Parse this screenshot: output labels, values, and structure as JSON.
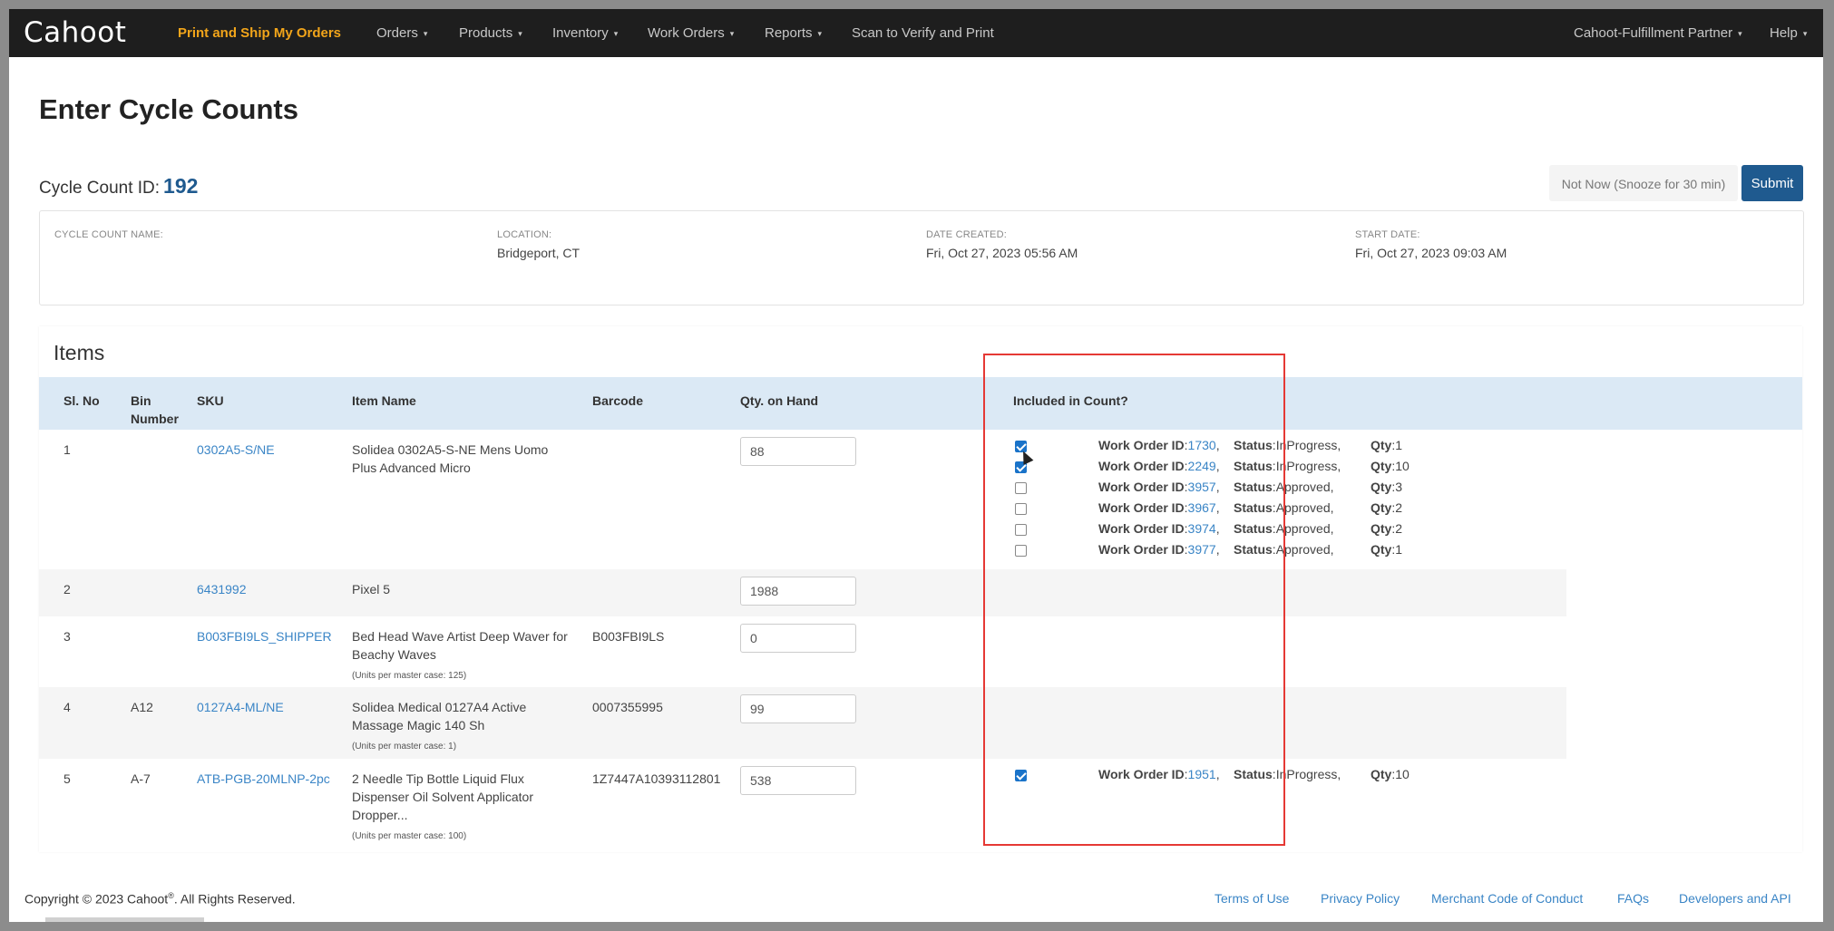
{
  "nav": {
    "logo": "Cahoot",
    "items": [
      {
        "label": "Print and Ship My Orders",
        "dropdown": false
      },
      {
        "label": "Orders",
        "dropdown": true
      },
      {
        "label": "Products",
        "dropdown": true
      },
      {
        "label": "Inventory",
        "dropdown": true
      },
      {
        "label": "Work Orders",
        "dropdown": true
      },
      {
        "label": "Reports",
        "dropdown": true
      },
      {
        "label": "Scan to Verify and Print",
        "dropdown": false
      }
    ],
    "account": "Cahoot-Fulfillment Partner",
    "help": "Help",
    "caret": "▾"
  },
  "page": {
    "title": "Enter Cycle Counts",
    "cycle_count_label": "Cycle Count ID:",
    "cycle_count_id": "192",
    "snooze_button": "Not Now (Snooze for 30 min)",
    "submit_button": "Submit"
  },
  "info": {
    "name_label": "CYCLE COUNT NAME:",
    "name_value": "",
    "location_label": "LOCATION:",
    "location_value": "Bridgeport, CT",
    "date_created_label": "DATE CREATED:",
    "date_created_value": "Fri, Oct 27, 2023 05:56 AM",
    "start_date_label": "START DATE:",
    "start_date_value": "Fri, Oct 27, 2023 09:03 AM"
  },
  "items": {
    "title": "Items",
    "headers": {
      "sl_no": "Sl. No",
      "bin_line1": "Bin",
      "bin_line2": "Number",
      "sku": "SKU",
      "item_name": "Item Name",
      "barcode": "Barcode",
      "qty_on_hand": "Qty. on Hand",
      "included": "Included in Count?"
    },
    "work_order_labels": {
      "id": "Work Order ID",
      "status": "Status",
      "qty": "Qty"
    },
    "rows": [
      {
        "sl": "1",
        "bin": "",
        "sku": "0302A5-S/NE",
        "name_line1": "Solidea 0302A5-S-NE Mens Uomo",
        "name_line2": "Plus Advanced Micro",
        "name_line3": "",
        "note": "",
        "barcode": "",
        "qty": "88",
        "work_orders": [
          {
            "id": "1730",
            "status": "InProgress",
            "qty": "1",
            "checked": true
          },
          {
            "id": "2249",
            "status": "InProgress",
            "qty": "10",
            "checked": true
          },
          {
            "id": "3957",
            "status": "Approved",
            "qty": "3",
            "checked": false
          },
          {
            "id": "3967",
            "status": "Approved",
            "qty": "2",
            "checked": false
          },
          {
            "id": "3974",
            "status": "Approved",
            "qty": "2",
            "checked": false
          },
          {
            "id": "3977",
            "status": "Approved",
            "qty": "1",
            "checked": false
          }
        ]
      },
      {
        "sl": "2",
        "bin": "",
        "sku": "6431992",
        "name_line1": "Pixel 5",
        "name_line2": "",
        "name_line3": "",
        "note": "",
        "barcode": "",
        "qty": "1988",
        "work_orders": []
      },
      {
        "sl": "3",
        "bin": "",
        "sku": "B003FBI9LS_SHIPPER",
        "name_line1": "Bed Head Wave Artist Deep Waver for",
        "name_line2": "Beachy Waves",
        "name_line3": "",
        "note": "(Units per master case: 125)",
        "barcode": "B003FBI9LS",
        "qty": "0",
        "work_orders": []
      },
      {
        "sl": "4",
        "bin": "A12",
        "sku": "0127A4-ML/NE",
        "name_line1": "Solidea Medical 0127A4 Active",
        "name_line2": "Massage Magic 140 Sh",
        "name_line3": "",
        "note": "(Units per master case: 1)",
        "barcode": "0007355995",
        "qty": "99",
        "work_orders": []
      },
      {
        "sl": "5",
        "bin": "A-7",
        "sku": "ATB-PGB-20MLNP-2pc",
        "name_line1": "2 Needle Tip Bottle Liquid Flux",
        "name_line2": "Dispenser Oil Solvent Applicator",
        "name_line3": "Dropper...",
        "note": "(Units per master case: 100)",
        "barcode": "1Z7447A10393112801",
        "qty": "538",
        "work_orders": [
          {
            "id": "1951",
            "status": "InProgress",
            "qty": "10",
            "checked": true
          }
        ]
      }
    ]
  },
  "footer": {
    "copyright_pre": "Copyright © 2023 Cahoot",
    "registered": "®",
    "copyright_post": ". All Rights Reserved.",
    "links": [
      "Terms of Use",
      "Privacy Policy",
      "Merchant Code of Conduct",
      "FAQs",
      "Developers and API"
    ]
  },
  "colors": {
    "navbar": "#1e1e1e",
    "nav_active": "#f2a51a",
    "primary": "#1f5a8f",
    "link": "#3a85c6",
    "highlight": "#e53935",
    "table_header": "#dbe9f5"
  }
}
